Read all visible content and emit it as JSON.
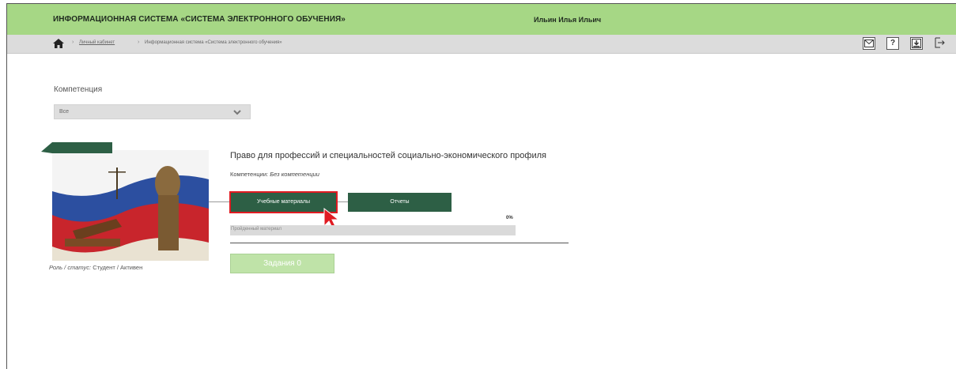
{
  "header": {
    "system_title": "ИНФОРМАЦИОННАЯ СИСТЕМА «СИСТЕМА ЭЛЕКТРОННОГО ОБУЧЕНИЯ»",
    "user_name": "Ильин Илья Ильич"
  },
  "breadcrumb": {
    "items": [
      {
        "label": "Личный кабинет"
      },
      {
        "label": "Информационная система «Система электронного обучения»"
      }
    ],
    "separator": "›"
  },
  "toolbar": {
    "icons": [
      "mail-icon",
      "help-icon",
      "download-icon",
      "logout-icon"
    ],
    "help_glyph": "?"
  },
  "filter": {
    "label": "Компетенция",
    "selected": "Все"
  },
  "course": {
    "title": "Право для профессий и специальностей социально-экономического профиля",
    "competence_prefix": "Компетенции: ",
    "competence_value": "Без компетенции",
    "role_prefix": "Роль / статус: ",
    "role_value": "Студент / Активен",
    "btn_materials": "Учебные материалы",
    "btn_reports": "Отчеты",
    "progress_label": "Пройденный материал",
    "progress_value": "0%",
    "progress_fraction": 0,
    "tasks_label": "Задания 0"
  },
  "colors": {
    "header_bg": "#a6d785",
    "button_green": "#2d5f45",
    "highlight_red": "#e01b22",
    "tasks_bg": "#bfe3a8"
  }
}
